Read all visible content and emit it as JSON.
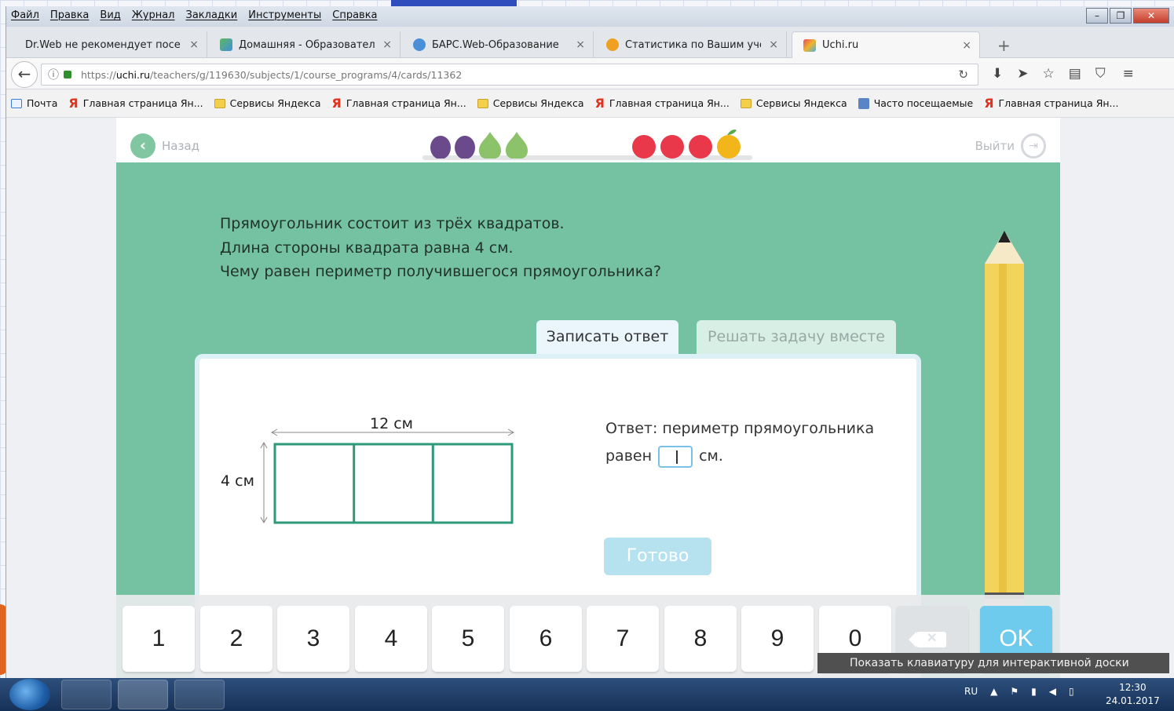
{
  "menu": [
    "Файл",
    "Правка",
    "Вид",
    "Журнал",
    "Закладки",
    "Инструменты",
    "Справка"
  ],
  "window_buttons": {
    "minimize": "–",
    "restore": "❐",
    "close": "✕"
  },
  "tabs": [
    {
      "title": "Dr.Web не рекомендует посе...",
      "close": "×"
    },
    {
      "title": "Домашняя - Образовател...",
      "close": "×"
    },
    {
      "title": "БАРС.Web-Образование",
      "close": "×"
    },
    {
      "title": "Статистика по Вашим уче...",
      "close": "×"
    },
    {
      "title": "Uchi.ru",
      "close": "×"
    }
  ],
  "new_tab": "+",
  "url": {
    "scheme": "https://",
    "host": "uchi.ru",
    "path": "/teachers/g/119630/subjects/1/course_programs/4/cards/11362"
  },
  "bookmarks": [
    {
      "label": "Почта",
      "icon": "mail-icon"
    },
    {
      "label": "Главная страница Ян...",
      "icon": "yandex-icon"
    },
    {
      "label": "Сервисы Яндекса",
      "icon": "folder-icon"
    },
    {
      "label": "Главная страница Ян...",
      "icon": "yandex-icon"
    },
    {
      "label": "Сервисы Яндекса",
      "icon": "folder-icon"
    },
    {
      "label": "Главная страница Ян...",
      "icon": "yandex-icon"
    },
    {
      "label": "Сервисы Яндекса",
      "icon": "folder-icon"
    },
    {
      "label": "Часто посещаемые",
      "icon": "frequent-icon"
    },
    {
      "label": "Главная страница Ян...",
      "icon": "yandex-icon"
    }
  ],
  "page": {
    "back": "Назад",
    "logout": "Выйти",
    "problem": [
      "Прямоугольник состоит из трёх квадратов.",
      "Длина стороны квадрата равна 4 см.",
      "Чему равен периметр получившегося прямоугольника?"
    ],
    "tab_answer": "Записать ответ",
    "tab_together": "Решать задачу вместе",
    "figure": {
      "top_label": "12 см",
      "side_label": "4 см"
    },
    "answer_prefix": "Ответ: периметр прямоугольника",
    "answer_line_before": "равен",
    "answer_line_after": "см.",
    "answer_value": "",
    "ready_button": "Готово"
  },
  "keyboard": {
    "keys": [
      "1",
      "2",
      "3",
      "4",
      "5",
      "6",
      "7",
      "8",
      "9",
      "0"
    ],
    "backspace": "✕",
    "ok": "OK"
  },
  "tooltip": "Показать клавиатуру для интерактивной доски",
  "taskbar": {
    "lang": "RU",
    "time": "12:30",
    "date": "24.01.2017"
  },
  "colors": {
    "page_green": "#74c2a2",
    "figure_stroke": "#2e9a7a",
    "ok_blue": "#6ecbed"
  }
}
